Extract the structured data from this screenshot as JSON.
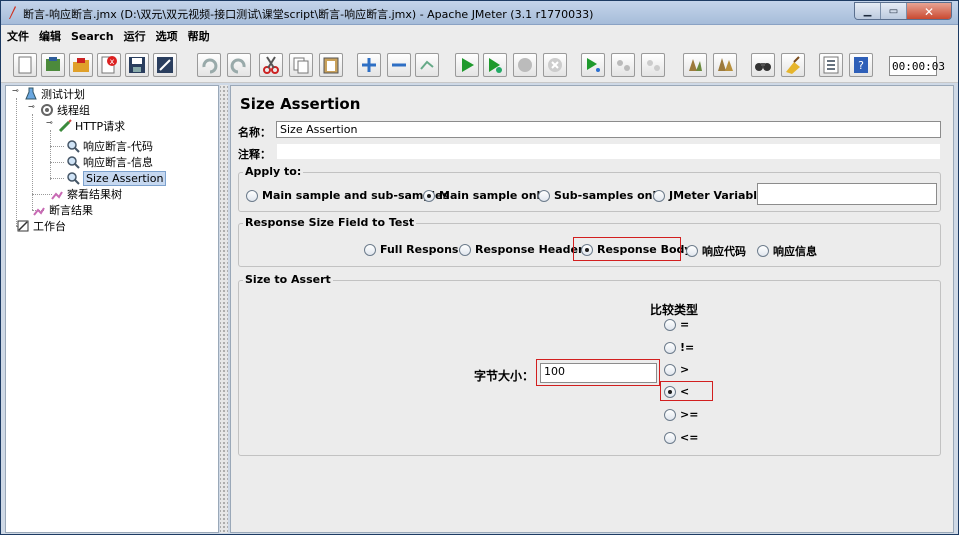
{
  "window": {
    "title": "断言-响应断言.jmx (D:\\双元\\双元视频-接口测试\\课堂script\\断言-响应断言.jmx) - Apache JMeter (3.1 r1770033)"
  },
  "menu": [
    "文件",
    "编辑",
    "Search",
    "运行",
    "选项",
    "帮助"
  ],
  "toolbar": {
    "timer": "00:00:03"
  },
  "tree": {
    "root": "测试计划",
    "thread_group": "线程组",
    "sampler": "HTTP请求",
    "assertion_code": "响应断言-代码",
    "assertion_info": "响应断言-信息",
    "assertion_size": "Size Assertion",
    "view_results": "察看结果树",
    "assertion_results": "断言结果",
    "workbench": "工作台"
  },
  "panel": {
    "title": "Size Assertion",
    "name_label": "名称：",
    "name_value": "Size Assertion",
    "comment_label": "注释：",
    "comment_value": "",
    "apply_to": {
      "title": "Apply to:",
      "options": [
        "Main sample and sub-samples",
        "Main sample only",
        "Sub-samples only",
        "JMeter Variable"
      ],
      "selected": 1,
      "variable_value": ""
    },
    "response_field": {
      "title": "Response Size Field to Test",
      "options": [
        "Full Response",
        "Response Headers",
        "Response Body",
        "响应代码",
        "响应信息"
      ],
      "selected": 2
    },
    "size_to_assert": {
      "title": "Size to Assert",
      "size_label": "字节大小：",
      "size_value": "100",
      "compare_title": "比较类型",
      "operators": [
        "=",
        "!=",
        ">",
        "<",
        ">=",
        "<="
      ],
      "selected": 3
    }
  },
  "colors": {
    "highlight": "#d21f1f",
    "selection": "#c6d8f0"
  }
}
